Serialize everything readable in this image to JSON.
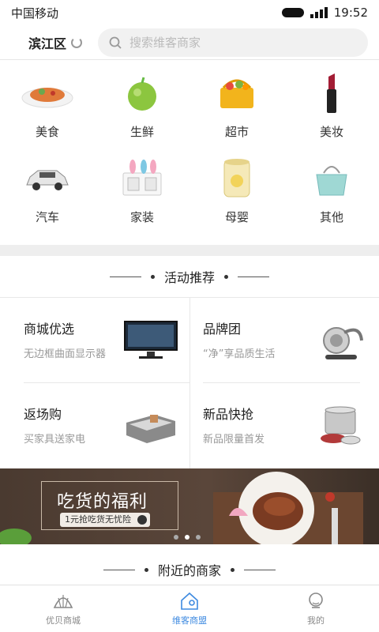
{
  "status": {
    "carrier": "中国移动",
    "time": "19:52"
  },
  "header": {
    "district": "滨江区",
    "search_placeholder": "搜索维客商家"
  },
  "categories": [
    {
      "label": "美食",
      "icon": "food-plate-icon"
    },
    {
      "label": "生鲜",
      "icon": "apple-icon"
    },
    {
      "label": "超市",
      "icon": "shopping-basket-icon"
    },
    {
      "label": "美妆",
      "icon": "lipstick-icon"
    },
    {
      "label": "汽车",
      "icon": "car-icon"
    },
    {
      "label": "家装",
      "icon": "wall-socket-icon"
    },
    {
      "label": "母婴",
      "icon": "milk-powder-can-icon"
    },
    {
      "label": "其他",
      "icon": "handbag-icon"
    }
  ],
  "activity": {
    "title": "活动推荐",
    "items": [
      {
        "title": "商城优选",
        "subtitle": "无边框曲面显示器",
        "icon": "monitor-icon"
      },
      {
        "title": "品牌团",
        "subtitle": "“净”享品质生活",
        "icon": "vacuum-cleaner-icon"
      },
      {
        "title": "返场购",
        "subtitle": "买家具送家电",
        "icon": "sofa-icon"
      },
      {
        "title": "新品快抢",
        "subtitle": "新品限量首发",
        "icon": "cookware-set-icon"
      }
    ]
  },
  "banner": {
    "title": "吃货的福利",
    "tag": "1元抢吃货无忧险"
  },
  "nearby": {
    "title": "附近的商家"
  },
  "tabs": [
    {
      "label": "优贝商城",
      "icon": "shell-icon"
    },
    {
      "label": "维客商盟",
      "icon": "location-home-icon",
      "active": true
    },
    {
      "label": "我的",
      "icon": "profile-icon"
    }
  ],
  "colors": {
    "accent": "#3e8ae0",
    "banner_bg": "#4a3a30"
  }
}
